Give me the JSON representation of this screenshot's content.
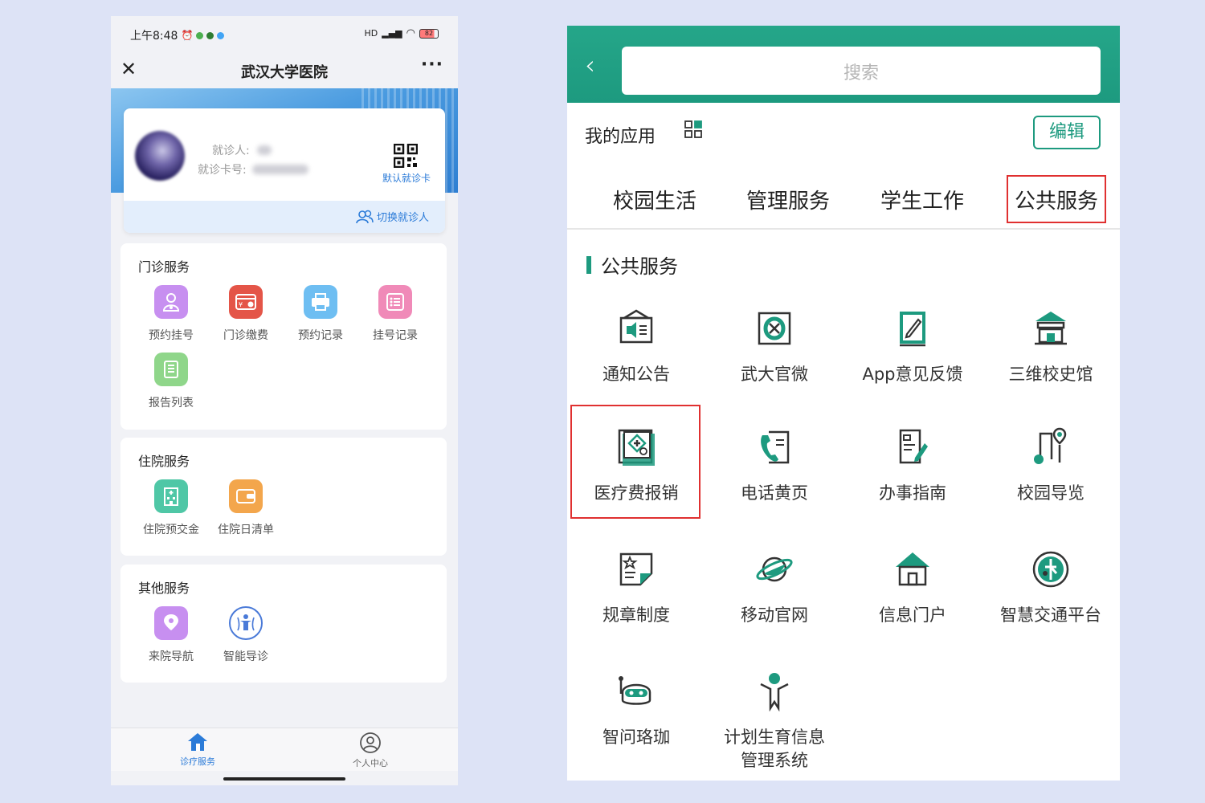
{
  "left": {
    "status": {
      "time": "上午8:48",
      "battery": "82",
      "signal": "HD"
    },
    "title": "武汉大学医院",
    "patient": {
      "name_label": "就诊人:",
      "card_label": "就诊卡号:",
      "qr_label": "默认就诊卡",
      "switch_label": "切换就诊人"
    },
    "outpatient": {
      "title": "门诊服务",
      "items": [
        {
          "label": "预约挂号",
          "color": "#c78ff0",
          "icon": "doctor-icon"
        },
        {
          "label": "门诊缴费",
          "color": "#e45548",
          "icon": "payment-card-icon"
        },
        {
          "label": "预约记录",
          "color": "#6ebef2",
          "icon": "printer-icon"
        },
        {
          "label": "挂号记录",
          "color": "#f08ab8",
          "icon": "list-icon"
        },
        {
          "label": "报告列表",
          "color": "#8fd68a",
          "icon": "report-icon"
        }
      ]
    },
    "inpatient": {
      "title": "住院服务",
      "items": [
        {
          "label": "住院预交金",
          "color": "#4fc7a6",
          "icon": "hospital-building-icon"
        },
        {
          "label": "住院日清单",
          "color": "#f3a64c",
          "icon": "wallet-icon"
        }
      ]
    },
    "other": {
      "title": "其他服务",
      "items": [
        {
          "label": "来院导航",
          "color": "#c78ff0",
          "icon": "location-pin-icon"
        },
        {
          "label": "智能导诊",
          "color": "#4a7ad8",
          "icon": "body-figure-icon"
        }
      ]
    },
    "nav": [
      {
        "label": "诊疗服务",
        "icon": "home-icon",
        "active": true
      },
      {
        "label": "个人中心",
        "icon": "user-icon",
        "active": false
      }
    ]
  },
  "right": {
    "search_placeholder": "搜索",
    "myapps_label": "我的应用",
    "edit_label": "编辑",
    "tabs": [
      "校园生活",
      "管理服务",
      "学生工作",
      "公共服务"
    ],
    "section_title": "公共服务",
    "apps": [
      {
        "label": "通知公告",
        "icon": "announcement-icon"
      },
      {
        "label": "武大官微",
        "icon": "wechat-official-icon"
      },
      {
        "label": "App意见反馈",
        "icon": "feedback-icon"
      },
      {
        "label": "三维校史馆",
        "icon": "museum-icon"
      },
      {
        "label": "医疗费报销",
        "icon": "medical-reimbursement-icon"
      },
      {
        "label": "电话黄页",
        "icon": "phone-book-icon"
      },
      {
        "label": "办事指南",
        "icon": "guide-icon"
      },
      {
        "label": "校园导览",
        "icon": "campus-map-icon"
      },
      {
        "label": "规章制度",
        "icon": "regulation-icon"
      },
      {
        "label": "移动官网",
        "icon": "planet-icon"
      },
      {
        "label": "信息门户",
        "icon": "house-icon"
      },
      {
        "label": "智慧交通平台",
        "icon": "traffic-icon"
      },
      {
        "label": "智问珞珈",
        "icon": "robot-icon"
      },
      {
        "label": "计划生育信息管理系统",
        "icon": "family-planning-icon"
      }
    ],
    "accent": "#1d9a7f",
    "highlight": "#e03030"
  }
}
